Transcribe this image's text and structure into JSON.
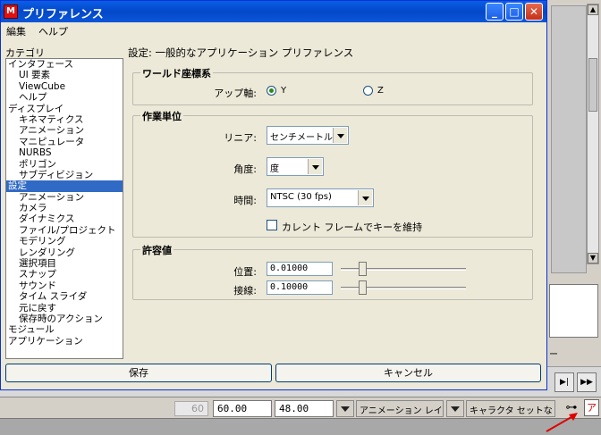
{
  "window": {
    "title": "プリファレンス",
    "controls": [
      "minimize",
      "maximize",
      "close"
    ]
  },
  "menu": {
    "edit": "編集",
    "help": "ヘルプ"
  },
  "categories": {
    "label": "カテゴリ",
    "items": [
      {
        "label": "インタフェース",
        "level": 1
      },
      {
        "label": "UI 要素",
        "level": 2
      },
      {
        "label": "ViewCube",
        "level": 2
      },
      {
        "label": "ヘルプ",
        "level": 2
      },
      {
        "label": "ディスプレイ",
        "level": 1
      },
      {
        "label": "キネマティクス",
        "level": 2
      },
      {
        "label": "アニメーション",
        "level": 2
      },
      {
        "label": "マニピュレータ",
        "level": 2
      },
      {
        "label": "NURBS",
        "level": 2
      },
      {
        "label": "ポリゴン",
        "level": 2
      },
      {
        "label": "サブディビジョン",
        "level": 2
      },
      {
        "label": "設定",
        "level": 1,
        "selected": true
      },
      {
        "label": "アニメーション",
        "level": 2
      },
      {
        "label": "カメラ",
        "level": 2
      },
      {
        "label": "ダイナミクス",
        "level": 2
      },
      {
        "label": "ファイル/プロジェクト",
        "level": 2
      },
      {
        "label": "モデリング",
        "level": 2
      },
      {
        "label": "レンダリング",
        "level": 2
      },
      {
        "label": "選択項目",
        "level": 2
      },
      {
        "label": "スナップ",
        "level": 2
      },
      {
        "label": "サウンド",
        "level": 2
      },
      {
        "label": "タイム スライダ",
        "level": 2
      },
      {
        "label": "元に戻す",
        "level": 2
      },
      {
        "label": "保存時のアクション",
        "level": 2
      },
      {
        "label": "モジュール",
        "level": 1
      },
      {
        "label": "アプリケーション",
        "level": 1
      }
    ]
  },
  "pane": {
    "title": "設定: 一般的なアプリケーション プリファレンス",
    "world_coords": {
      "title": "ワールド座標系",
      "up_axis_label": "アップ軸:",
      "options": [
        "Y",
        "Z"
      ],
      "selected": "Y"
    },
    "working_units": {
      "title": "作業単位",
      "linear_label": "リニア:",
      "linear_value": "センチメートル",
      "angle_label": "角度:",
      "angle_value": "度",
      "time_label": "時間:",
      "time_value": "NTSC (30 fps)",
      "keep_keys_label": "カレント フレームでキーを維持",
      "keep_keys_checked": false
    },
    "tolerance": {
      "title": "許容値",
      "position_label": "位置:",
      "position_value": "0.01000",
      "position_slider": 0.15,
      "tangent_label": "接線:",
      "tangent_value": "0.10000",
      "tangent_slider": 0.15
    }
  },
  "buttons": {
    "save": "保存",
    "cancel": "キャンセル"
  },
  "background": {
    "range_start": "60",
    "range_end_field": "60.00",
    "playback_end_field": "48.00",
    "anim_layer_label": "アニメーション レイヤ",
    "character_label": "キャラクタ セットなし",
    "ruler_frames": [
      "00",
      ""
    ],
    "side_label": "ー"
  },
  "colors": {
    "title_bar": "#0348c8",
    "selection": "#316ac5",
    "dialog_bg": "#ece9d8",
    "annotation_arrow": "#e00000"
  }
}
